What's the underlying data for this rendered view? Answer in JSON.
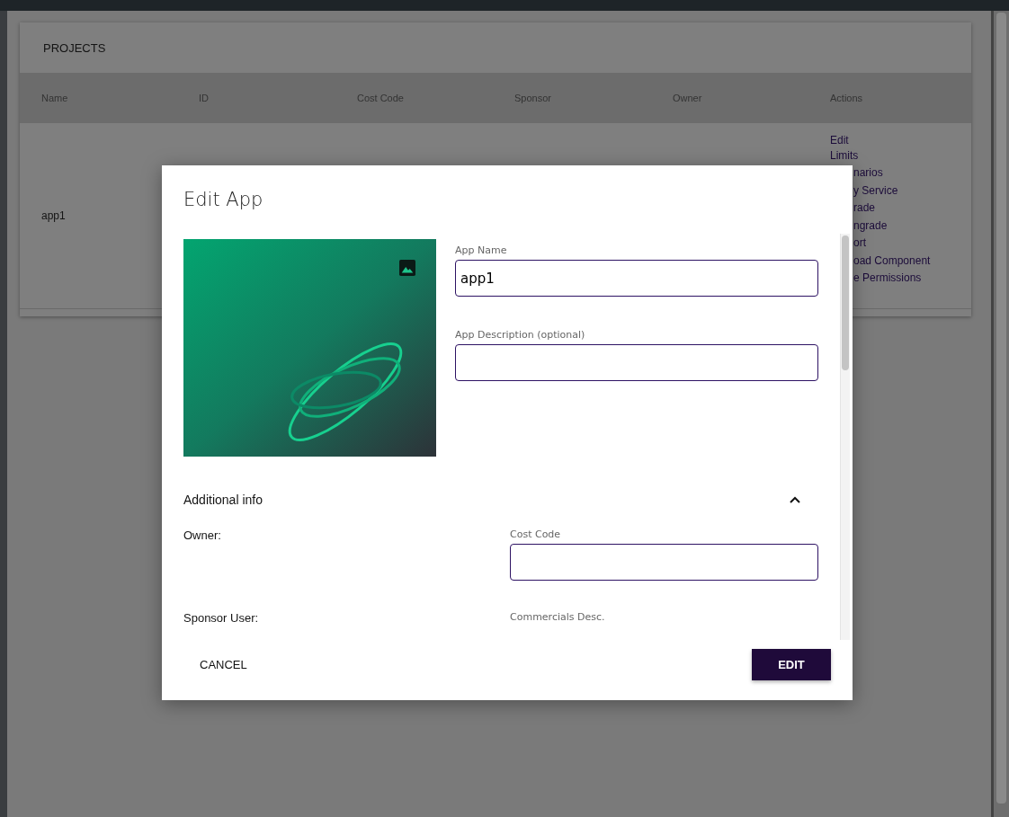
{
  "page": {
    "title": "PROJECTS",
    "table": {
      "columns": [
        "Name",
        "ID",
        "Cost Code",
        "Sponsor",
        "Owner",
        "Actions"
      ],
      "rows": [
        {
          "name": "app1",
          "actions": [
            "Edit",
            "Limits",
            "narios",
            "y Service",
            "rade",
            "ngrade",
            "ort",
            "oad Component",
            "e Permissions"
          ]
        }
      ]
    }
  },
  "dialog": {
    "title": "Edit App",
    "fields": [
      {
        "label": "App Name",
        "value": "app1"
      },
      {
        "label": "App Description (optional)"
      }
    ],
    "additional_info": {
      "title": "Additional info",
      "expanded": true,
      "owner_label": "Owner:",
      "sponsor_label": "Sponsor User:",
      "cost_code_label": "Cost Code",
      "commercials_label": "Commercials Desc."
    },
    "buttons": {
      "cancel": "CANCEL",
      "confirm": "EDIT"
    }
  }
}
